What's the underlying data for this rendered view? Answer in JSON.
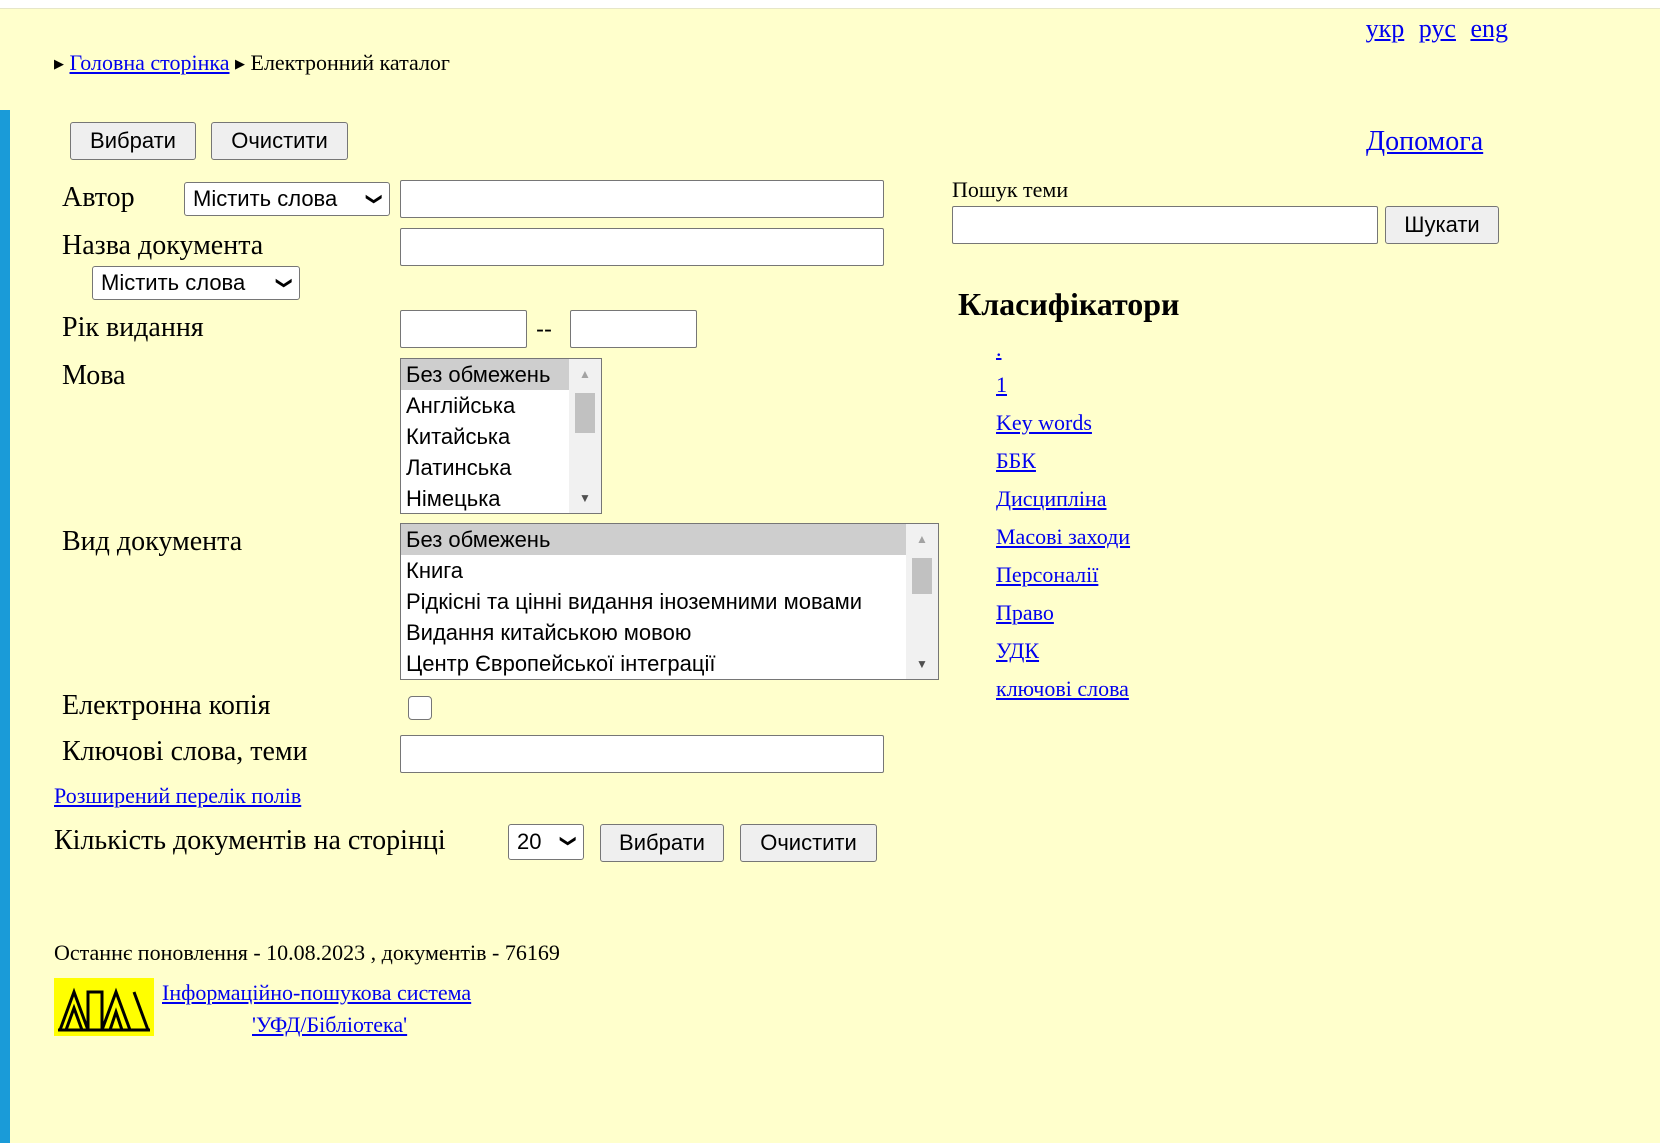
{
  "languages": [
    "укр",
    "рус",
    "eng"
  ],
  "breadcrumb": {
    "home": "Головна сторінка",
    "current": "Електронний каталог"
  },
  "buttons": {
    "select": "Вибрати",
    "clear": "Очистити",
    "search": "Шукати"
  },
  "help": "Допомога",
  "form": {
    "author_label": "Автор",
    "author_mode": "Містить слова",
    "title_label": "Назва документа",
    "title_mode": "Містить слова",
    "year_label": "Рік видання",
    "year_sep": "--",
    "language_label": "Мова",
    "language_options": [
      "Без обмежень",
      "Англійська",
      "Китайська",
      "Латинська",
      "Німецька"
    ],
    "doctype_label": "Вид документа",
    "doctype_options": [
      "Без обмежень",
      "Книга",
      "Рідкісні та цінні видання іноземними мовами",
      "Видання китайською мовою",
      "Центр Європейської інтеграції"
    ],
    "ecopy_label": "Електронна копія",
    "keywords_label": "Ключові слова, теми",
    "extended_link": "Розширений перелік полів",
    "perpage_label": "Кількість документів на сторінці",
    "perpage_value": "20"
  },
  "topic_search": {
    "label": "Пошук теми"
  },
  "classifiers": {
    "heading": "Класифікатори",
    "items": [
      ".",
      "1",
      "Key words",
      "ББК",
      "Дисципліна",
      "Масові заходи",
      "Персоналії",
      "Право",
      "УДК",
      "ключові слова"
    ]
  },
  "footer": {
    "last_update": "Останнє поновлення - 10.08.2023 , документів - 76169",
    "system_line1": "Інформаційно-пошукова система",
    "system_line2": "'УФД/Бібліотека'"
  }
}
